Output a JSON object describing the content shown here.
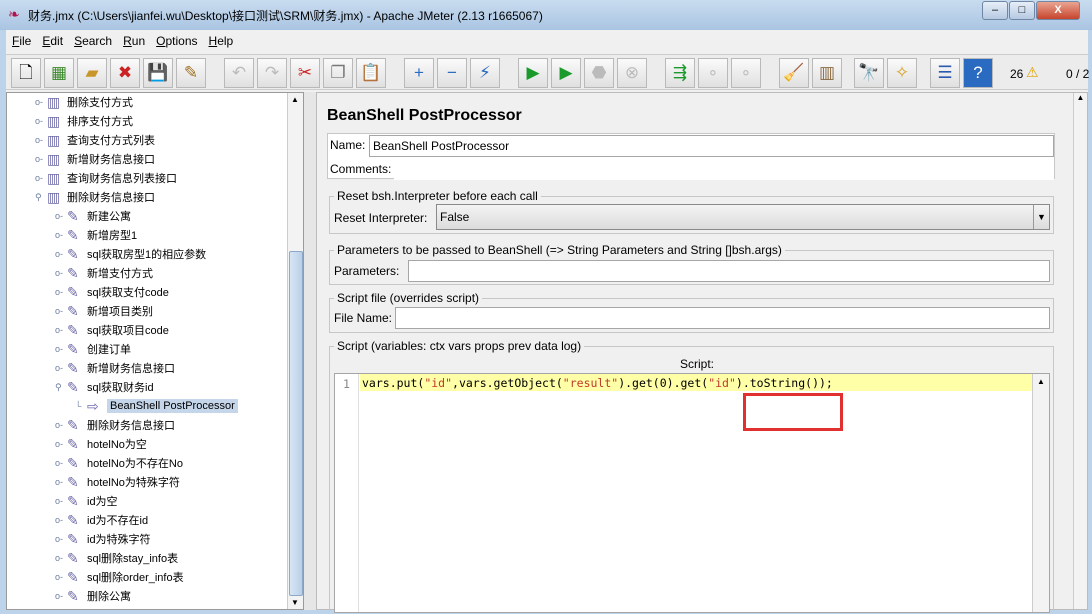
{
  "window": {
    "title": "财务.jmx (C:\\Users\\jianfei.wu\\Desktop\\接口测试\\SRM\\财务.jmx) - Apache JMeter (2.13 r1665067)",
    "minimize": "–",
    "maximize": "□",
    "close": "X"
  },
  "menu": [
    "File",
    "Edit",
    "Search",
    "Run",
    "Options",
    "Help"
  ],
  "toolbar": {
    "warning_count": "26",
    "thread_count": "0 / 2"
  },
  "tree": [
    {
      "label": "删除支付方式",
      "level": 1
    },
    {
      "label": "排序支付方式",
      "level": 1
    },
    {
      "label": "查询支付方式列表",
      "level": 1
    },
    {
      "label": "新增财务信息接口",
      "level": 1
    },
    {
      "label": "查询财务信息列表接口",
      "level": 1
    },
    {
      "label": "删除财务信息接口",
      "level": 1
    },
    {
      "label": "新建公寓",
      "level": 2
    },
    {
      "label": "新增房型1",
      "level": 2
    },
    {
      "label": "sql获取房型1的相应参数",
      "level": 2
    },
    {
      "label": "新增支付方式",
      "level": 2
    },
    {
      "label": "sql获取支付code",
      "level": 2
    },
    {
      "label": "新增项目类别",
      "level": 2
    },
    {
      "label": "sql获取项目code",
      "level": 2
    },
    {
      "label": "创建订单",
      "level": 2
    },
    {
      "label": "新增财务信息接口",
      "level": 2
    },
    {
      "label": "sql获取财务id",
      "level": 2
    },
    {
      "label": "BeanShell PostProcessor",
      "level": 3,
      "selected": true
    },
    {
      "label": "删除财务信息接口",
      "level": 2
    },
    {
      "label": "hotelNo为空",
      "level": 2
    },
    {
      "label": "hotelNo为不存在No",
      "level": 2
    },
    {
      "label": "hotelNo为特殊字符",
      "level": 2
    },
    {
      "label": "id为空",
      "level": 2
    },
    {
      "label": "id为不存在id",
      "level": 2
    },
    {
      "label": "id为特殊字符",
      "level": 2
    },
    {
      "label": "sql删除stay_info表",
      "level": 2
    },
    {
      "label": "sql删除order_info表",
      "level": 2
    },
    {
      "label": "删除公寓",
      "level": 2
    }
  ],
  "panel": {
    "title": "BeanShell PostProcessor",
    "name_label": "Name:",
    "name_value": "BeanShell PostProcessor",
    "comments_label": "Comments:",
    "comments_value": "",
    "reset_group": "Reset bsh.Interpreter before each call",
    "reset_label": "Reset Interpreter:",
    "reset_value": "False",
    "params_group": "Parameters to be passed to BeanShell (=> String Parameters and String []bsh.args)",
    "params_label": "Parameters:",
    "params_value": "",
    "file_group": "Script file (overrides script)",
    "file_label": "File Name:",
    "file_value": "",
    "script_group": "Script (variables: ctx vars props prev data log)",
    "script_label": "Script:",
    "line_number": "1",
    "code": {
      "p1": "vars.put(",
      "s1": "\"id\"",
      "p2": ",vars.getObject(",
      "s2": "\"result\"",
      "p3": ").get(0).get(",
      "s3": "\"id\"",
      "p4": ").toString());"
    }
  },
  "colors": {
    "highlight_box": "#e03030",
    "code_line_bg": "#ffffa8",
    "selection": "#c5d6ea"
  }
}
